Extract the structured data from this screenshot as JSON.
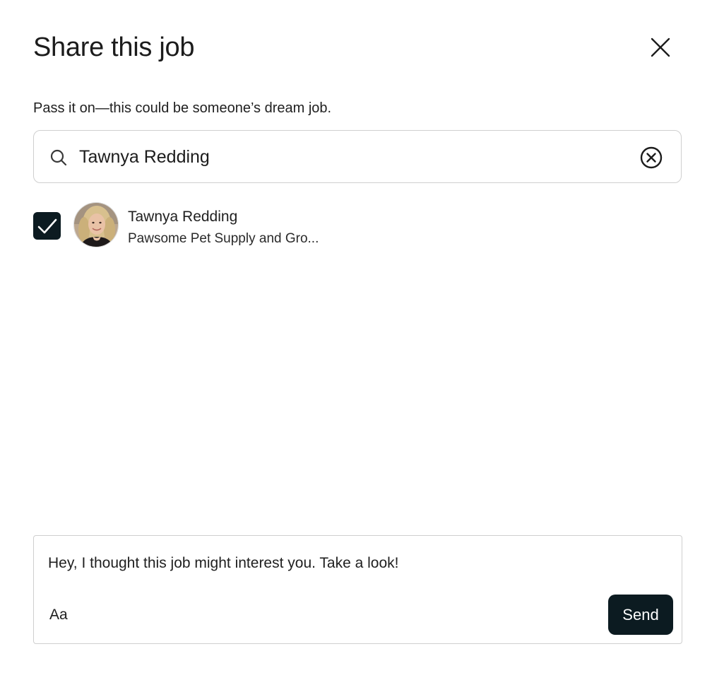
{
  "dialog": {
    "title": "Share this job",
    "subtitle": "Pass it on—this could be someone’s dream job."
  },
  "search": {
    "value": "Tawnya Redding",
    "placeholder": "",
    "icon": "search-icon",
    "clear_icon": "clear-circle-x-icon"
  },
  "results": [
    {
      "name": "Tawnya Redding",
      "subtitle": "Pawsome Pet Supply and Gro...",
      "checked": true
    }
  ],
  "message": {
    "text": "Hey, I thought this job might interest you. Take a look!",
    "format_label": "Aa",
    "send_label": "Send"
  },
  "colors": {
    "primary_dark": "#0c1b21",
    "border": "#cfcfcf",
    "text": "#1f1f1f"
  }
}
